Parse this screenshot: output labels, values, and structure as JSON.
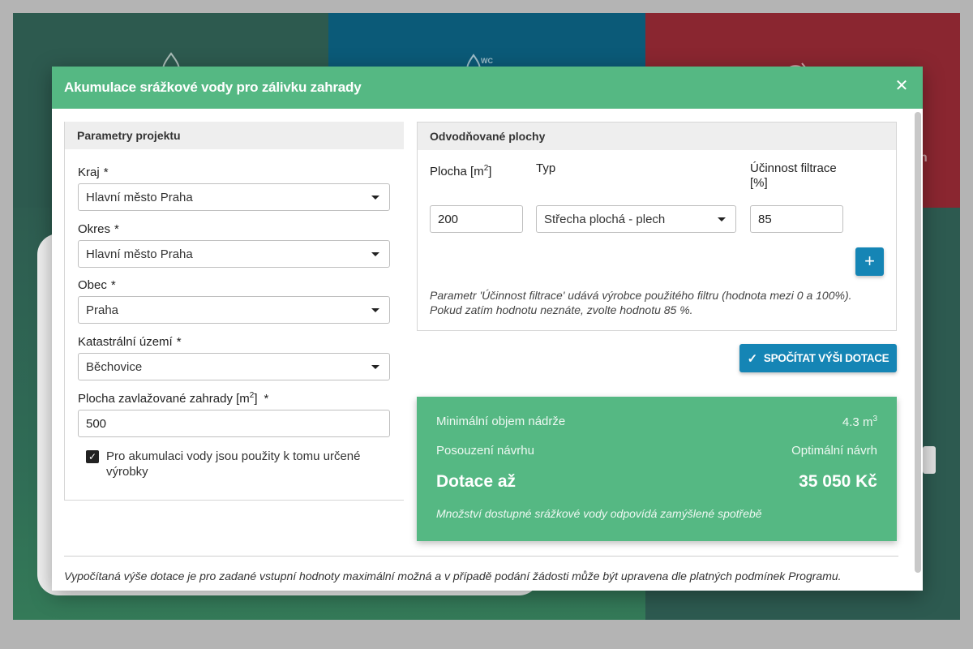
{
  "modal": {
    "title": "Akumulace srážkové vody pro zálivku zahrady",
    "close_icon": "close-icon"
  },
  "project": {
    "heading": "Parametry projektu",
    "kraj_label": "Kraj",
    "kraj_value": "Hlavní město Praha",
    "okres_label": "Okres",
    "okres_value": "Hlavní město Praha",
    "obec_label": "Obec",
    "obec_value": "Praha",
    "katastr_label": "Katastrální území",
    "katastr_value": "Běchovice",
    "plocha_label": "Plocha zavlažované zahrady [m",
    "plocha_unit_sup": "2",
    "plocha_label_end": "]",
    "plocha_value": "500",
    "required_mark": "*",
    "checkbox_label": "Pro akumulaci vody jsou použity k tomu určené výrobky",
    "checkbox_checked": true
  },
  "surfaces": {
    "heading": "Odvodňované plochy",
    "col_plocha": "Plocha [m",
    "col_plocha_sup": "2",
    "col_plocha_end": "]",
    "col_typ": "Typ",
    "col_ucinnost": "Účinnost filtrace [%]",
    "row_plocha": "200",
    "row_typ": "Střecha plochá - plech",
    "row_ucinnost": "85",
    "add_label": "+",
    "hint_line1": "Parametr 'Účinnost filtrace' udává výrobce použitého filtru (hodnota mezi 0 a 100%).",
    "hint_line2": "Pokud zatím hodnotu neznáte, zvolte hodnotu 85 %."
  },
  "calculate_button": "SPOČÍTAT VÝŠI DOTACE",
  "result": {
    "min_volume_label": "Minimální objem nádrže",
    "min_volume_value": "4.3 m",
    "min_volume_sup": "3",
    "assessment_label": "Posouzení návrhu",
    "assessment_value": "Optimální návrh",
    "subsidy_label": "Dotace až",
    "subsidy_value": "35 050 Kč",
    "note": "Množství dostupné srážkové vody odpovídá zamýšlené spotřebě"
  },
  "footer_note": "Vypočítaná výše dotace je pro zadané vstupní hodnoty maximální možná a v případě podání žádosti může být upravena dle platných podmínek Programu.",
  "background": {
    "partial_letter": "n"
  },
  "colors": {
    "accent_green": "#55b883",
    "button_blue": "#1585b5",
    "tile_dark_green": "#2d5a4f",
    "tile_blue": "#0b5a78",
    "tile_red": "#8a2630"
  }
}
